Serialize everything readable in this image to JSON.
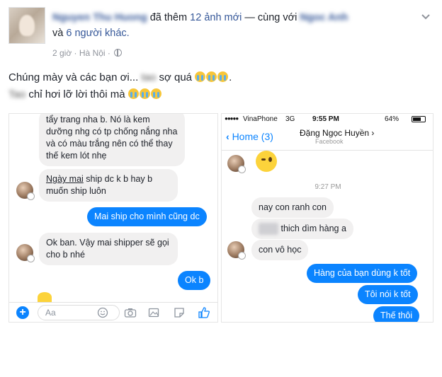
{
  "post": {
    "author": "Nguyen Thu Huong",
    "action": "đã thêm",
    "photo_count_label": "12 ảnh mới",
    "with_prefix": "— cùng với",
    "tagged_person": "Ngoc Anh",
    "and_label": "và",
    "others_label": "6 người khác.",
    "time": "2 giờ",
    "location": "Hà Nội",
    "caption_line1_a": "Chúng mày và các bạn ơi...",
    "caption_line1_hidden": "tao",
    "caption_line1_b": "sợ quá",
    "caption_line1_end": ".",
    "caption_line2_hidden": "Tao",
    "caption_line2": "chỉ hơi lỡ lời thôi mà"
  },
  "left_chat": {
    "msg1": "tẩy trang nha b. Nó là kem dưỡng nhg có tp chống nắng nha và có màu trắng nên có thể thay thế kem lót nhẹ",
    "msg2_underlined": "Ngày mai",
    "msg2_rest": " ship dc k b hay b muốn ship luôn",
    "out1": "Mai ship cho mình cũng dc",
    "msg3": "Ok ban. Vậy mai shipper sẽ gọi cho b nhé",
    "out2": "Ok b",
    "composer_placeholder": "Aa"
  },
  "right_chat": {
    "carrier": "VinaPhone",
    "network": "3G",
    "clock": "9:55 PM",
    "battery": "64%",
    "back_label": "Home (3)",
    "contact_name": "Đặng Ngọc Huyền",
    "contact_sub": "Facebook",
    "time_divider": "9:27 PM",
    "in1": "nay con ranh con",
    "in2_rest": "thich dìm hàng a",
    "in3": "con vô học",
    "out1": "Hàng của bạn dùng k tốt",
    "out2": "Tôi nói k tốt",
    "out3": "Thế thôi"
  },
  "icons": [
    "globe-icon",
    "chevron-down-icon",
    "crying-emoji-icon",
    "plus-icon",
    "smiley-icon",
    "camera-icon",
    "image-icon",
    "sticker-icon",
    "like-icon",
    "wink-emoji-icon"
  ]
}
